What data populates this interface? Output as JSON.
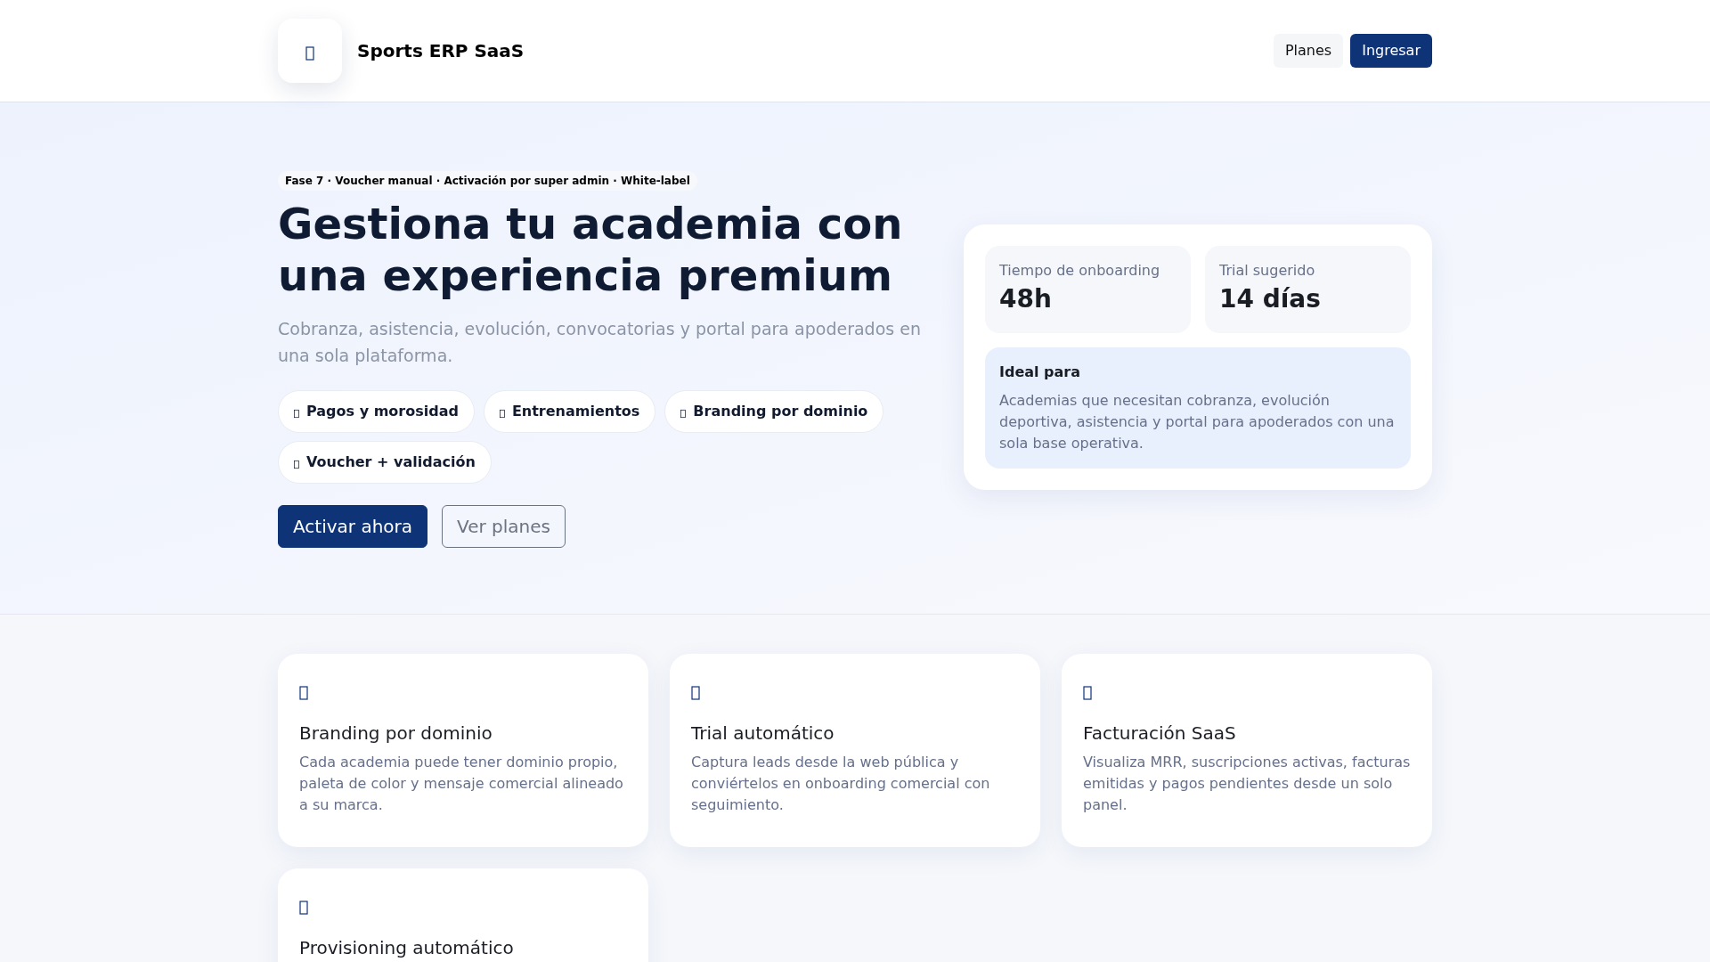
{
  "header": {
    "brand": "Sports ERP SaaS",
    "nav": [
      {
        "label": "Planes",
        "kind": "ghost"
      },
      {
        "label": "Ingresar",
        "kind": "primary"
      }
    ]
  },
  "hero": {
    "badge": "Fase 7 · Voucher manual · Activación por super admin · White-label",
    "title": "Gestiona tu academia con una experiencia premium",
    "subtitle": "Cobranza, asistencia, evolución, convocatorias y portal para apoderados en una sola plataforma.",
    "chips": [
      "Pagos y morosidad",
      "Entrenamientos",
      "Branding por dominio",
      "Voucher + validación"
    ],
    "actions": [
      {
        "label": "Activar ahora",
        "kind": "primary"
      },
      {
        "label": "Ver planes",
        "kind": "outline"
      }
    ],
    "stats": [
      {
        "label": "Tiempo de onboarding",
        "value": "48h"
      },
      {
        "label": "Trial sugerido",
        "value": "14 días"
      }
    ],
    "ideal": {
      "title": "Ideal para",
      "text": "Academias que necesitan cobranza, evolución deportiva, asistencia y portal para apoderados con una sola base operativa."
    }
  },
  "features": [
    {
      "title": "Branding por dominio",
      "text": "Cada academia puede tener dominio propio, paleta de color y mensaje comercial alineado a su marca."
    },
    {
      "title": "Trial automático",
      "text": "Captura leads desde la web pública y conviértelos en onboarding comercial con seguimiento."
    },
    {
      "title": "Facturación SaaS",
      "text": "Visualiza MRR, suscripciones activas, facturas emitidas y pagos pendientes desde un solo panel."
    },
    {
      "title": "Provisioning automático"
    }
  ]
}
